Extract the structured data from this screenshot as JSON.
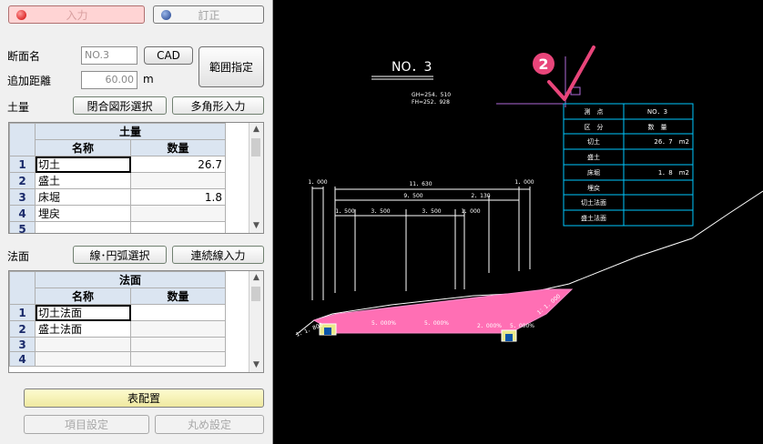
{
  "mode": {
    "input_label": "入力",
    "correct_label": "訂正"
  },
  "section": {
    "name_label": "断面名",
    "name_value": "NO.3",
    "cad_button": "CAD",
    "distance_label": "追加距離",
    "distance_value": "60.00",
    "distance_unit": "m",
    "range_button": "範囲指定"
  },
  "earth": {
    "label": "土量",
    "closed_button": "閉合図形選択",
    "polygon_button": "多角形入力",
    "table_title": "土量",
    "col_name": "名称",
    "col_qty": "数量",
    "rows": [
      {
        "num": "1",
        "name": "切土",
        "qty": "26.7"
      },
      {
        "num": "2",
        "name": "盛土",
        "qty": ""
      },
      {
        "num": "3",
        "name": "床堀",
        "qty": "1.8"
      },
      {
        "num": "4",
        "name": "埋戻",
        "qty": ""
      },
      {
        "num": "5",
        "name": "",
        "qty": ""
      }
    ]
  },
  "slope": {
    "label": "法面",
    "line_button": "線･円弧選択",
    "cont_button": "連続線入力",
    "table_title": "法面",
    "col_name": "名称",
    "col_qty": "数量",
    "rows": [
      {
        "num": "1",
        "name": "切土法面",
        "qty": ""
      },
      {
        "num": "2",
        "name": "盛土法面",
        "qty": ""
      },
      {
        "num": "3",
        "name": "",
        "qty": ""
      },
      {
        "num": "4",
        "name": "",
        "qty": ""
      }
    ]
  },
  "footer": {
    "place_button": "表配置",
    "item_button": "項目設定",
    "round_button": "丸め設定"
  },
  "cad": {
    "section_title": "NO．3",
    "gh": "GH=254．510",
    "fh": "FH=252．928",
    "dims": {
      "total": "11．630",
      "mid": "9．500",
      "right": "2．130",
      "left_edge": "1．000",
      "right_edge": "1．000",
      "seg1": "1．500",
      "seg2": "3．500",
      "seg3": "3．500",
      "seg4": "1．000"
    },
    "slopes": {
      "left": "1：1．800",
      "a": "5．000%",
      "b": "5．000%",
      "c": "2．000%",
      "d": "5．000%",
      "right": "1：1．000"
    },
    "table": {
      "rows": [
        {
          "label": "測　点",
          "value": "NO．3"
        },
        {
          "label": "区　分",
          "value": "数　量"
        },
        {
          "label": "切土",
          "value": "26．7　m2"
        },
        {
          "label": "盛土",
          "value": ""
        },
        {
          "label": "床堀",
          "value": "1．8　m2"
        },
        {
          "label": "埋戻",
          "value": ""
        },
        {
          "label": "切土法面",
          "value": ""
        },
        {
          "label": "盛土法面",
          "value": ""
        }
      ]
    },
    "step_badge": "2"
  },
  "colors": {
    "accent": "#e8457a",
    "cyan": "#00c8ff",
    "cad_bg": "#000000",
    "header_blue": "#dbe5f1"
  }
}
